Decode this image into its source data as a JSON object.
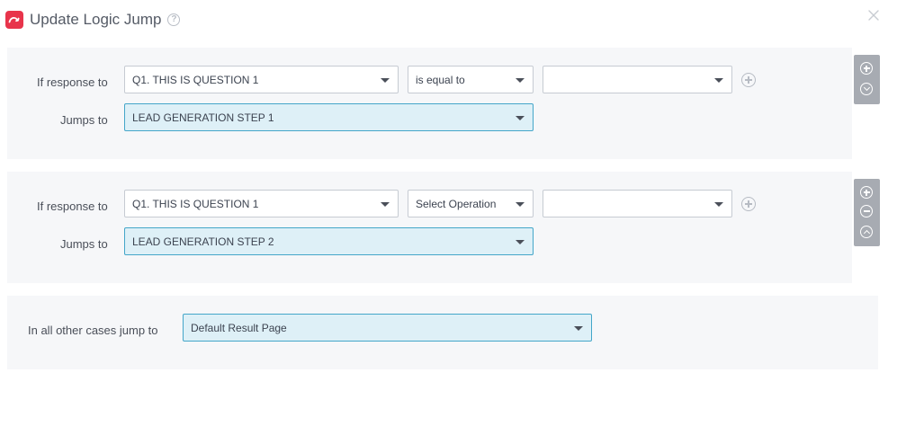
{
  "header": {
    "title": "Update Logic Jump",
    "help_icon": "question-circle-icon",
    "close_icon": "close-icon",
    "brand_color": "#e8344b"
  },
  "rules": [
    {
      "if_label": "If response to",
      "question": "Q1. THIS IS QUESTION 1",
      "operation": "is equal to",
      "value": "",
      "jumps_label": "Jumps to",
      "jump_target": "LEAD GENERATION STEP 1"
    },
    {
      "if_label": "If response to",
      "question": "Q1. THIS IS QUESTION 1",
      "operation": "Select Operation",
      "value": "",
      "jumps_label": "Jumps to",
      "jump_target": "LEAD GENERATION STEP 2"
    }
  ],
  "default_rule": {
    "label": "In all other cases jump to",
    "target": "Default Result Page"
  },
  "colors": {
    "accent_border": "#44a6c9",
    "accent_fill": "#def0f7",
    "panel_bg": "#f6f7f9",
    "side_controls": "#a7abb2"
  }
}
